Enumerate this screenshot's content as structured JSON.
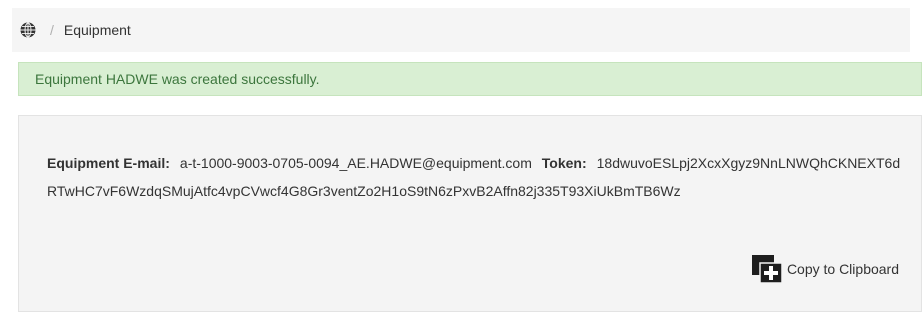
{
  "breadcrumb": {
    "home_icon": "globe-icon",
    "separator": "/",
    "current": "Equipment"
  },
  "alert": {
    "message": "Equipment HADWE was created successfully.",
    "color": "#3c763d",
    "background": "#d9efd3"
  },
  "details": {
    "email_label": "Equipment E-mail:",
    "email_value": "a-t-1000-9003-0705-0094_AE.HADWE@equipment.com",
    "token_label": "Token:",
    "token_value": "18dwuvoESLpj2XcxXgyz9NnLNWQhCKNEXT6dRTwHC7vF6WzdqSMujAtfc4vpCVwcf4G8Gr3ventZo2H1oS9tN6zPxvB2Affn82j335T93XiUkBmTB6Wz"
  },
  "copy_button": {
    "icon": "copy-clipboard-icon",
    "label": "Copy to Clipboard"
  }
}
